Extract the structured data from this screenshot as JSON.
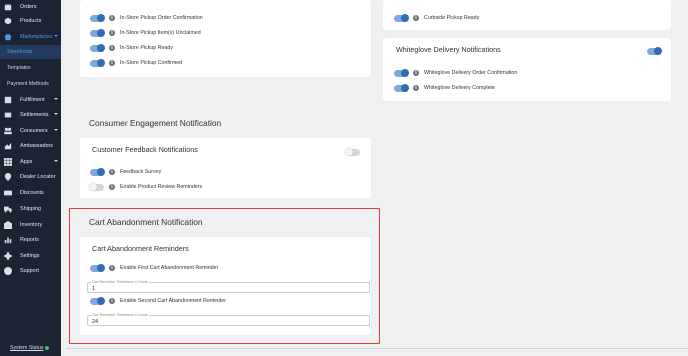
{
  "sidebar": {
    "items": [
      {
        "label": "Orders",
        "icon": "orders-icon"
      },
      {
        "label": "Products",
        "icon": "products-icon"
      },
      {
        "label": "Marketplaces",
        "icon": "marketplaces-icon"
      },
      {
        "label": "Fulfillment",
        "icon": "fulfillment-icon"
      },
      {
        "label": "Settlements",
        "icon": "settlements-icon"
      },
      {
        "label": "Consumers",
        "icon": "consumers-icon"
      },
      {
        "label": "Ambassadors",
        "icon": "ambassadors-icon"
      },
      {
        "label": "Apps",
        "icon": "apps-icon"
      },
      {
        "label": "Dealer Locator",
        "icon": "location-pin-icon"
      },
      {
        "label": "Discounts",
        "icon": "discounts-icon"
      },
      {
        "label": "Shipping",
        "icon": "truck-icon"
      },
      {
        "label": "Inventory",
        "icon": "inventory-icon"
      },
      {
        "label": "Reports",
        "icon": "reports-icon"
      },
      {
        "label": "Settings",
        "icon": "gear-icon"
      },
      {
        "label": "Support",
        "icon": "help-icon"
      }
    ],
    "sub_items": [
      {
        "label": "Storefronts"
      },
      {
        "label": "Templates"
      },
      {
        "label": "Payment Methods"
      }
    ],
    "system_status": "System Status"
  },
  "store_pickup": {
    "rows": [
      {
        "label": "In-Store Pickup Order Confirmation",
        "on": true
      },
      {
        "label": "In-Store Pickup Item(s) Unclaimed",
        "on": true
      },
      {
        "label": "In-Store Pickup Ready",
        "on": true
      },
      {
        "label": "In-Store Pickup Confirmed",
        "on": true
      }
    ]
  },
  "curbside": {
    "rows": [
      {
        "label": "Curbside Pickup Ready",
        "on": true
      }
    ]
  },
  "whiteglove": {
    "title": "Whiteglove Delivery Notifications",
    "rows": [
      {
        "label": "Whiteglove Delivery Order Confirmation",
        "on": true
      },
      {
        "label": "Whiteglove Delivery Complete",
        "on": true
      }
    ]
  },
  "consumer_engagement": {
    "section_title": "Consumer Engagement Notification",
    "card_title": "Customer Feedback Notifications",
    "rows": [
      {
        "label": "Feedback Survey",
        "on": true
      },
      {
        "label": "Enable Product Review Reminders",
        "on": false
      }
    ]
  },
  "cart_abandonment": {
    "section_title": "Cart Abandonment Notification",
    "card_title": "Cart Abandonment Reminders",
    "first_label": "Enable First Cart Abandonment Reminder",
    "first_field_label": "Cart Reminder Timeframe in Hours",
    "first_field_value": "1",
    "second_label": "Enable Second Cart Abandonment Reminder",
    "second_field_label": "Cart Reminder Timeframe in Hours",
    "second_field_value": "24"
  },
  "colors": {
    "sidebar_bg": "#1c2434",
    "accent": "#2f6eb5",
    "highlight_border": "#e53935"
  }
}
